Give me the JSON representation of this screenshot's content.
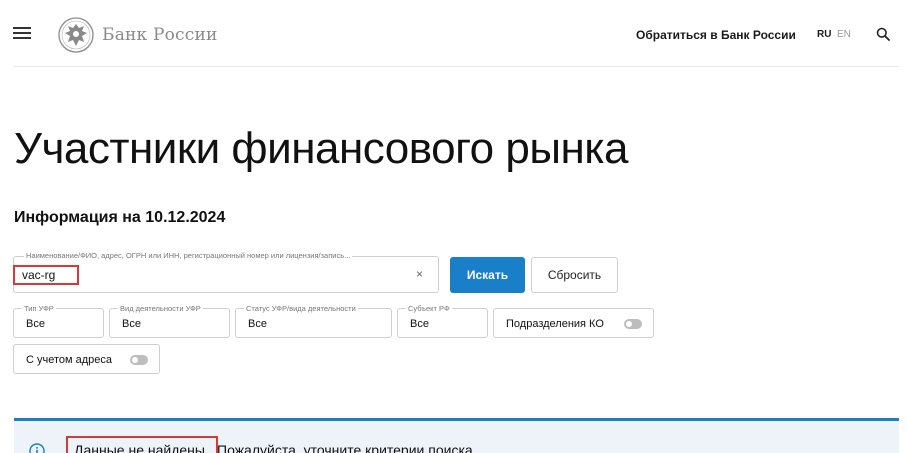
{
  "header": {
    "logo_text": "Банк России",
    "contact_link": "Обратиться в Банк России",
    "lang_ru": "RU",
    "lang_en": "EN"
  },
  "page": {
    "title": "Участники финансового рынка",
    "subtitle": "Информация на 10.12.2024"
  },
  "search": {
    "label": "Наименование/ФИО, адрес, ОГРН или ИНН, регистрационный номер или лицензия/запись...",
    "value": "vac-rg",
    "clear_symbol": "×",
    "search_button": "Искать",
    "reset_button": "Сбросить"
  },
  "filters": [
    {
      "label": "Тип УФР",
      "value": "Все"
    },
    {
      "label": "Вид деятельности УФР",
      "value": "Все"
    },
    {
      "label": "Статус УФР/вида деятельности",
      "value": "Все"
    },
    {
      "label": "Субъект РФ",
      "value": "Все"
    }
  ],
  "toggles": {
    "ko_label": "Подразделения КО",
    "ko_on": false,
    "address_label": "С учетом адреса",
    "address_on": false
  },
  "banner": {
    "text_highlighted": "Данные не найдены.",
    "text_rest": "Пожалуйста, уточните критерии поиска."
  },
  "colors": {
    "accent": "#1a7fc9",
    "highlight": "#d33a3a",
    "banner_bg": "#edf3f9"
  }
}
